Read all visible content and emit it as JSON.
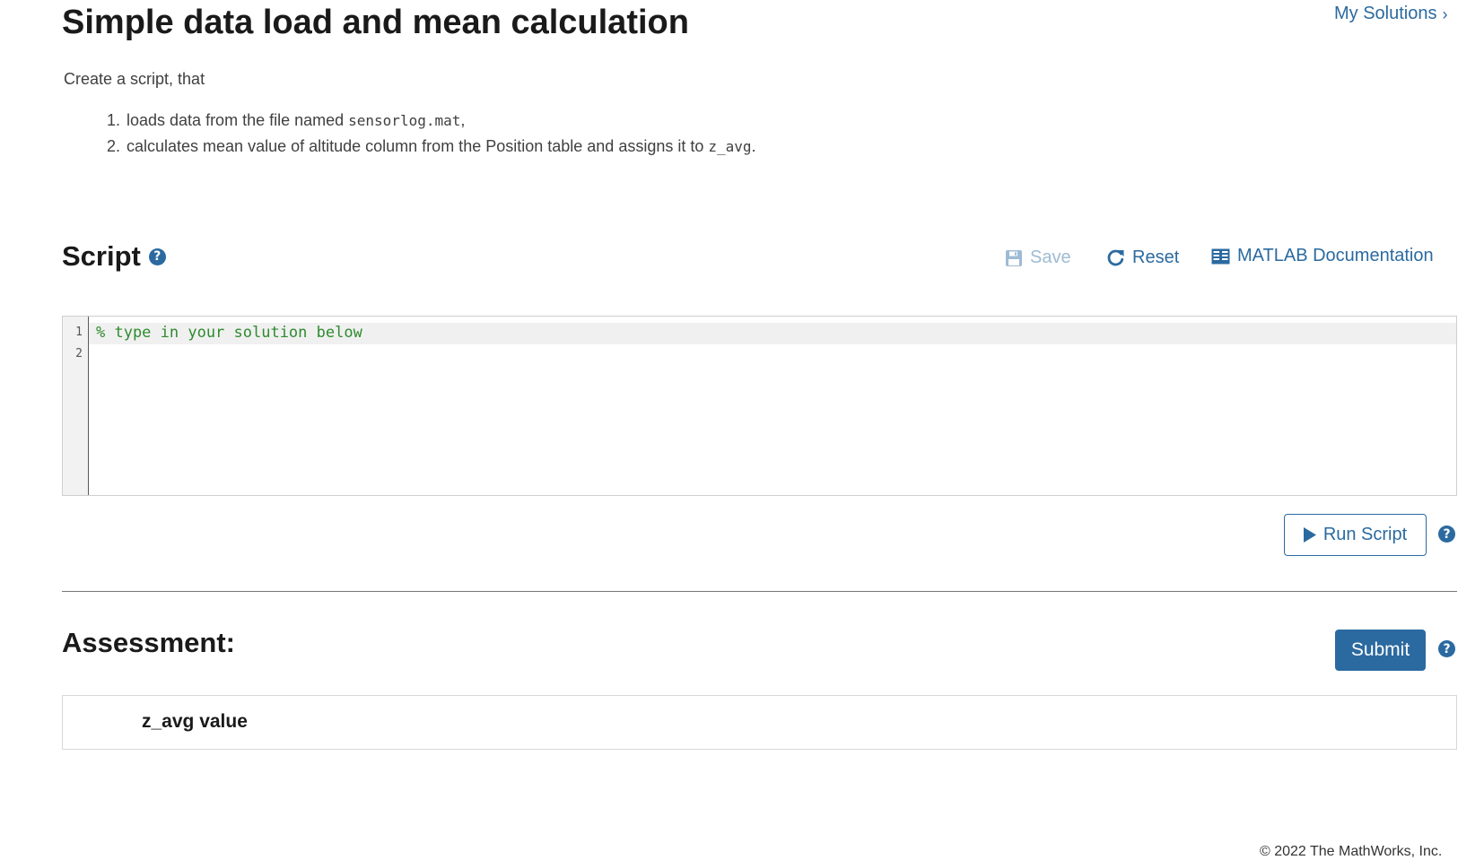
{
  "header": {
    "title": "Simple data load and mean calculation",
    "my_solutions_label": "My Solutions",
    "my_solutions_chevron": "›"
  },
  "description": {
    "intro": "Create a script, that",
    "steps": [
      {
        "number": "1.",
        "text_before": "loads data from the file named ",
        "code": "sensorlog.mat",
        "text_after": ","
      },
      {
        "number": "2.",
        "text_before": "calculates mean value of altitude column from the Position table and assigns it to ",
        "code": "z_avg",
        "text_after": "."
      }
    ]
  },
  "script": {
    "title": "Script",
    "help_glyph": "?",
    "toolbar": {
      "save_label": "Save",
      "save_icon": "floppy-disk-icon",
      "save_enabled": false,
      "reset_label": "Reset",
      "reset_icon": "refresh-icon",
      "doc_label": "MATLAB Documentation",
      "doc_icon": "book-icon"
    },
    "editor": {
      "lines": [
        {
          "number": "1",
          "text": "% type in your solution below"
        },
        {
          "number": "2",
          "text": ""
        }
      ],
      "comment_color": "#2e8b2e"
    },
    "run_label": "Run Script",
    "run_icon": "play-icon"
  },
  "assessment": {
    "title": "Assessment:",
    "submit_label": "Submit",
    "help_glyph": "?",
    "tests": [
      {
        "label": "z_avg value"
      }
    ]
  },
  "footer": {
    "copyright": "© 2022 The MathWorks, Inc."
  },
  "colors": {
    "accent": "#2b6aa0",
    "disabled": "#9ebbd4"
  }
}
